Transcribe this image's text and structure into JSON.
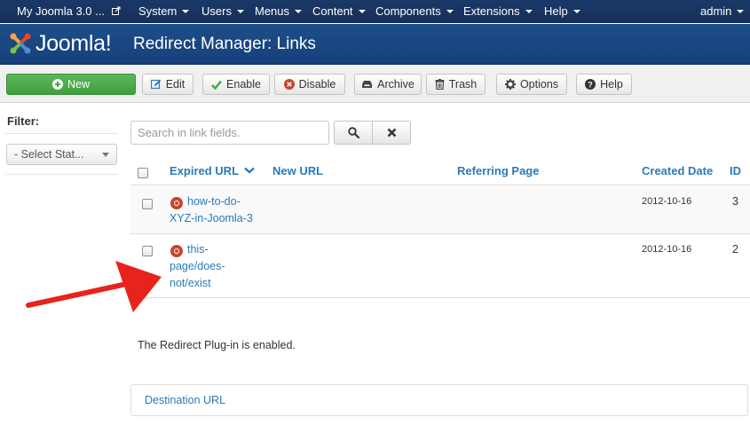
{
  "topbar": {
    "site_name": "My Joomla 3.0 ...",
    "menus": [
      "System",
      "Users",
      "Menus",
      "Content",
      "Components",
      "Extensions",
      "Help"
    ],
    "user": "admin"
  },
  "header": {
    "logo_text": "Joomla!",
    "title": "Redirect Manager: Links"
  },
  "toolbar": {
    "new": "New",
    "edit": "Edit",
    "enable": "Enable",
    "disable": "Disable",
    "archive": "Archive",
    "trash": "Trash",
    "options": "Options",
    "help": "Help"
  },
  "sidebar": {
    "filter_label": "Filter:",
    "status_select": "- Select Stat..."
  },
  "search": {
    "placeholder": "Search in link fields."
  },
  "table": {
    "headers": {
      "expired_url": "Expired URL",
      "new_url": "New URL",
      "referring_page": "Referring Page",
      "created_date": "Created Date",
      "id": "ID"
    },
    "rows": [
      {
        "expired_url": "how-to-do-XYZ-in-Joomla-3",
        "new_url": "",
        "referring_page": "",
        "created_date": "2012-10-16",
        "id": "3"
      },
      {
        "expired_url": "this-page/does-not/exist",
        "new_url": "",
        "referring_page": "",
        "created_date": "2012-10-16",
        "id": "2"
      }
    ]
  },
  "plugin_message": "The Redirect Plug-in is enabled.",
  "destination_url_label": "Destination URL",
  "colors": {
    "topbar": "#17305a",
    "header": "#1d4e8a",
    "link": "#2a7ab8",
    "new_button": "#46a546",
    "status_unpublished": "#c6462e",
    "annotation_arrow": "#e8231c"
  }
}
